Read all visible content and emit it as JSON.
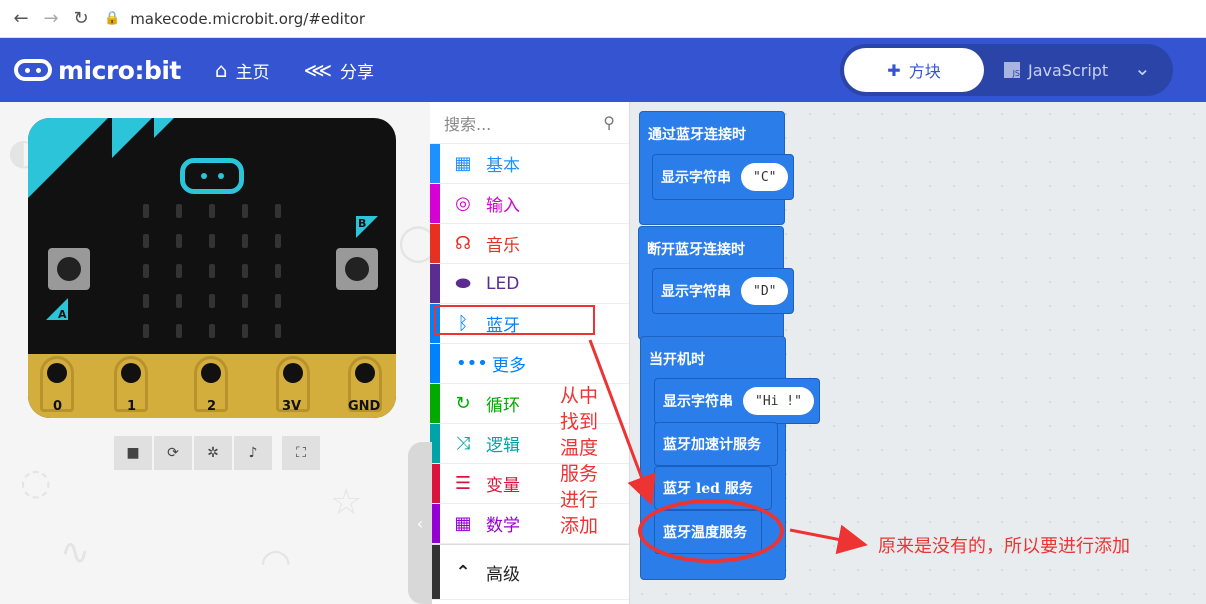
{
  "browser": {
    "url": "makecode.microbit.org/#editor"
  },
  "header": {
    "logo": "micro:bit",
    "home_label": "主页",
    "share_label": "分享",
    "blocks_label": "方块",
    "javascript_label": "JavaScript"
  },
  "simulator": {
    "pins": [
      "0",
      "1",
      "2",
      "3V",
      "GND"
    ],
    "button_a": "A",
    "button_b": "B"
  },
  "toolbox": {
    "search_placeholder": "搜索...",
    "categories": [
      {
        "label": "基本",
        "color": "#1e90ff",
        "icon": "grid-icon"
      },
      {
        "label": "输入",
        "color": "#d400d4",
        "icon": "target-icon"
      },
      {
        "label": "音乐",
        "color": "#e63022",
        "icon": "headphones-icon"
      },
      {
        "label": "LED",
        "color": "#5c2d91",
        "icon": "toggle-icon"
      },
      {
        "label": "蓝牙",
        "color": "#0082fb",
        "icon": "bluetooth-icon"
      },
      {
        "label": "更多",
        "color": "#0082fb",
        "icon": "dots-icon"
      },
      {
        "label": "循环",
        "color": "#00aa00",
        "icon": "loop-icon"
      },
      {
        "label": "逻辑",
        "color": "#00a4a6",
        "icon": "shuffle-icon"
      },
      {
        "label": "变量",
        "color": "#dc143c",
        "icon": "lines-icon"
      },
      {
        "label": "数学",
        "color": "#9400d3",
        "icon": "calculator-icon"
      }
    ],
    "advanced_label": "高级"
  },
  "workspace": {
    "block1": {
      "title": "通过蓝牙连接时",
      "stmt": "显示字符串",
      "str": "\"C\""
    },
    "block2": {
      "title": "断开蓝牙连接时",
      "stmt": "显示字符串",
      "str": "\"D\""
    },
    "block3": {
      "title": "当开机时",
      "stmt1": "显示字符串",
      "str1": "\"Hi !\"",
      "stmt2": "蓝牙加速计服务",
      "stmt3": "蓝牙 led 服务",
      "stmt4": "蓝牙温度服务"
    }
  },
  "annotations": {
    "find_text": [
      "从中",
      "找到",
      "温度",
      "服务",
      "进行",
      "添加"
    ],
    "note": "原来是没有的，所以要进行添加",
    "color": "#e33333"
  }
}
